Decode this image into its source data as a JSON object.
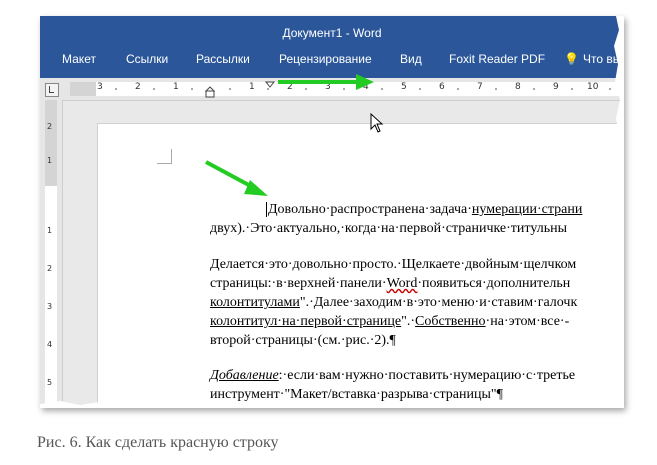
{
  "window": {
    "title": "Документ1 - Word"
  },
  "ribbon": {
    "tabs": [
      "Макет",
      "Ссылки",
      "Рассылки",
      "Рецензирование",
      "Вид",
      "Foxit Reader PDF"
    ],
    "tell_me": "Что вы"
  },
  "ruler": {
    "horizontal_labels": [
      "3",
      "2",
      "1",
      "1",
      "2",
      "3",
      "4",
      "5",
      "6",
      "7",
      "8",
      "9",
      "10"
    ],
    "vertical_labels": [
      "2",
      "1",
      "1",
      "2",
      "3",
      "4",
      "5"
    ]
  },
  "document": {
    "p1_l1_a": "Довольно·распространена·задача·",
    "p1_l1_b": "нумерации·страни",
    "p1_l2": "двух).·Это·актуально,·когда·на·первой·страничке·титульны",
    "p2_l1": "Делается·это·довольно·просто.·Щелкаете·двойным·щелчком",
    "p2_l2_a": "страницы:·в·верхней·панели·",
    "p2_l2_b": "Word",
    "p2_l2_c": "·появиться·дополнительн",
    "p2_l3_a": "колонтитулами",
    "p2_l3_b": "\".·Далее·заходим·в·это·меню·и·ставим·галочк",
    "p2_l4_a": "колонтитул·на·первой·странице",
    "p2_l4_b": "\".·",
    "p2_l4_c": "Собственно",
    "p2_l4_d": "·на·этом·все·-",
    "p2_l5": "второй·страницы·(см.·рис.·2).¶",
    "p3_l1_a": "Добавление",
    "p3_l1_b": ":·если·вам·нужно·поставить·нумерацию·с·третье",
    "p3_l2": "инструмент·\"Макет/вставка·разрыва·страницы\"¶"
  },
  "caption": "Рис. 6. Как сделать красную строку",
  "colors": {
    "ribbon": "#2b579a",
    "arrow": "#22cc22",
    "caption": "#555555"
  }
}
